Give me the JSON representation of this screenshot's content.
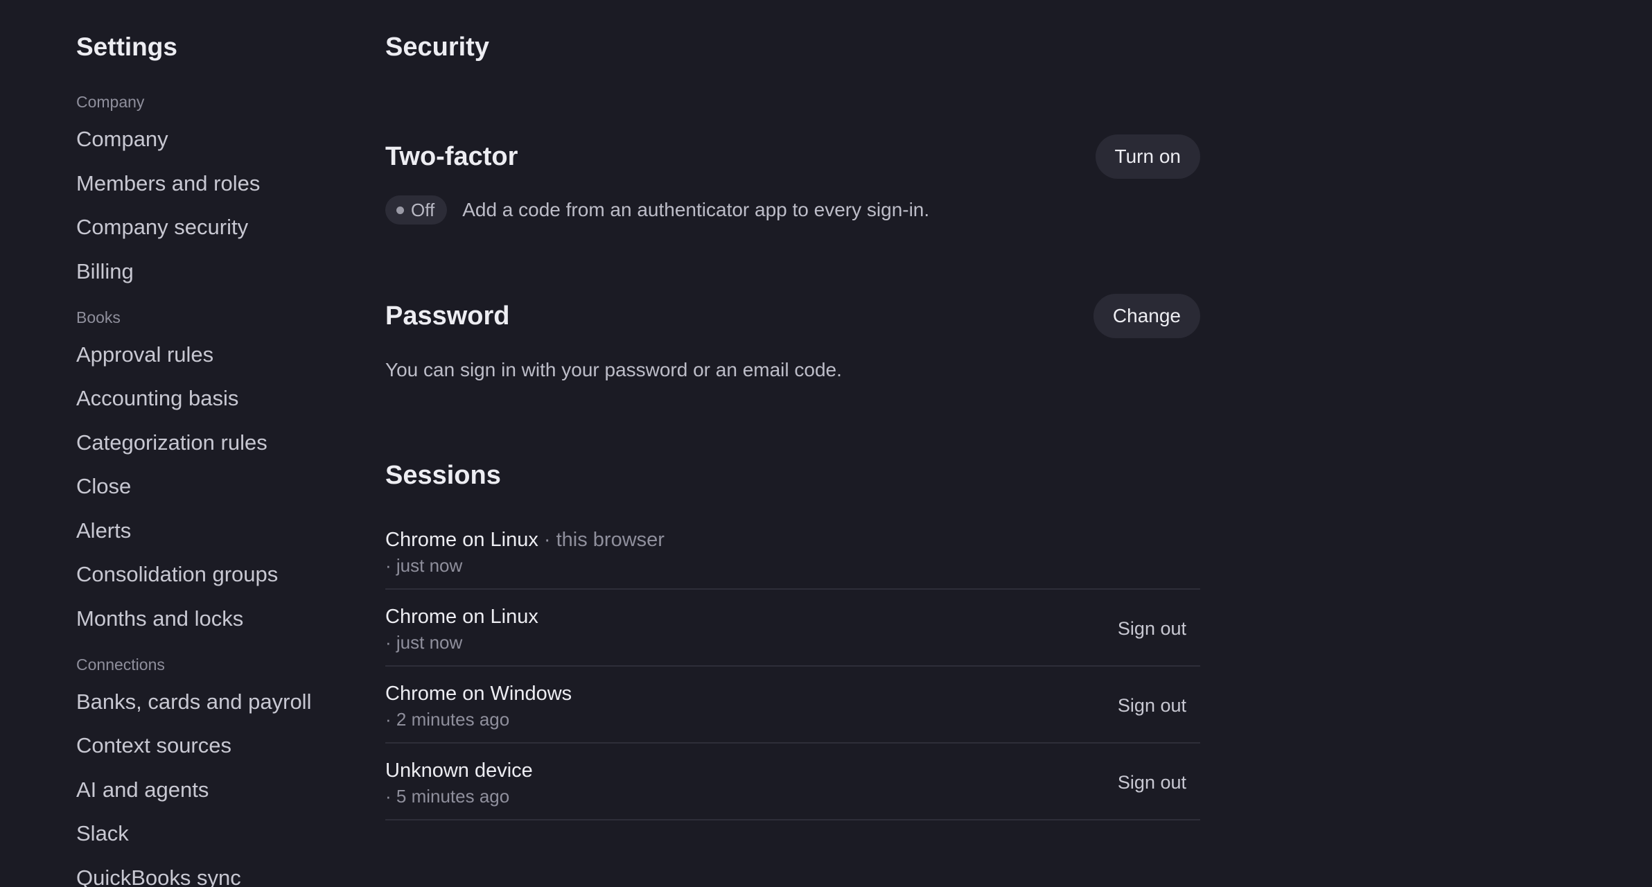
{
  "sidebar": {
    "title": "Settings",
    "groups": [
      {
        "label": "Company",
        "items": [
          "Company",
          "Members and roles",
          "Company security",
          "Billing"
        ]
      },
      {
        "label": "Books",
        "items": [
          "Approval rules",
          "Accounting basis",
          "Categorization rules",
          "Close",
          "Alerts",
          "Consolidation groups",
          "Months and locks"
        ]
      },
      {
        "label": "Connections",
        "items": [
          "Banks, cards and payroll",
          "Context sources",
          "AI and agents",
          "Slack",
          "QuickBooks sync"
        ]
      }
    ]
  },
  "main": {
    "title": "Security",
    "two_factor": {
      "title": "Two-factor",
      "button": "Turn on",
      "status": "Off",
      "description": "Add a code from an authenticator app to every sign-in."
    },
    "password": {
      "title": "Password",
      "button": "Change",
      "description": "You can sign in with your password or an email code."
    },
    "sessions": {
      "title": "Sessions",
      "items": [
        {
          "name": "Chrome on Linux",
          "note": " · this browser",
          "time": "· just now",
          "action": ""
        },
        {
          "name": "Chrome on Linux",
          "note": "",
          "time": "· just now",
          "action": "Sign out"
        },
        {
          "name": "Chrome on Windows",
          "note": "",
          "time": "· 2 minutes ago",
          "action": "Sign out"
        },
        {
          "name": "Unknown device",
          "note": "",
          "time": "· 5 minutes ago",
          "action": "Sign out"
        }
      ]
    }
  }
}
